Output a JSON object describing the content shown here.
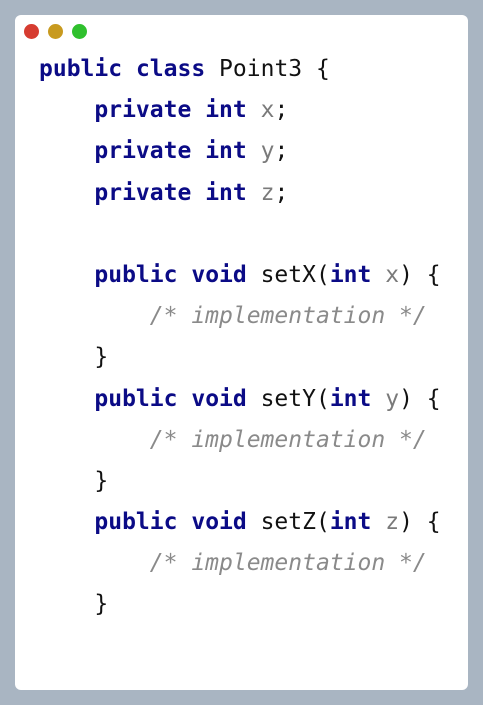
{
  "window": {
    "controls": [
      {
        "name": "close",
        "color": "#d63c31"
      },
      {
        "name": "minimize",
        "color": "#c89a1f"
      },
      {
        "name": "maximize",
        "color": "#2fc02d"
      }
    ]
  },
  "code": {
    "lines": [
      {
        "indent": "",
        "tokens": [
          {
            "t": "public",
            "k": "kw"
          },
          {
            "t": " ",
            "k": "plain"
          },
          {
            "t": "class",
            "k": "kw"
          },
          {
            "t": " Point3 {",
            "k": "plain"
          }
        ]
      },
      {
        "indent": "    ",
        "tokens": [
          {
            "t": "private",
            "k": "kw"
          },
          {
            "t": " ",
            "k": "plain"
          },
          {
            "t": "int",
            "k": "kw"
          },
          {
            "t": " ",
            "k": "plain"
          },
          {
            "t": "x",
            "k": "var"
          },
          {
            "t": ";",
            "k": "plain"
          }
        ]
      },
      {
        "indent": "    ",
        "tokens": [
          {
            "t": "private",
            "k": "kw"
          },
          {
            "t": " ",
            "k": "plain"
          },
          {
            "t": "int",
            "k": "kw"
          },
          {
            "t": " ",
            "k": "plain"
          },
          {
            "t": "y",
            "k": "var"
          },
          {
            "t": ";",
            "k": "plain"
          }
        ]
      },
      {
        "indent": "    ",
        "tokens": [
          {
            "t": "private",
            "k": "kw"
          },
          {
            "t": " ",
            "k": "plain"
          },
          {
            "t": "int",
            "k": "kw"
          },
          {
            "t": " ",
            "k": "plain"
          },
          {
            "t": "z",
            "k": "var"
          },
          {
            "t": ";",
            "k": "plain"
          }
        ]
      },
      {
        "indent": "",
        "tokens": []
      },
      {
        "indent": "    ",
        "tokens": [
          {
            "t": "public",
            "k": "kw"
          },
          {
            "t": " ",
            "k": "plain"
          },
          {
            "t": "void",
            "k": "kw"
          },
          {
            "t": " setX(",
            "k": "plain"
          },
          {
            "t": "int",
            "k": "kw"
          },
          {
            "t": " ",
            "k": "plain"
          },
          {
            "t": "x",
            "k": "var"
          },
          {
            "t": ") {",
            "k": "plain"
          }
        ]
      },
      {
        "indent": "        ",
        "tokens": [
          {
            "t": "/* implementation */",
            "k": "comment"
          }
        ]
      },
      {
        "indent": "    ",
        "tokens": [
          {
            "t": "}",
            "k": "plain"
          }
        ]
      },
      {
        "indent": "    ",
        "tokens": [
          {
            "t": "public",
            "k": "kw"
          },
          {
            "t": " ",
            "k": "plain"
          },
          {
            "t": "void",
            "k": "kw"
          },
          {
            "t": " setY(",
            "k": "plain"
          },
          {
            "t": "int",
            "k": "kw"
          },
          {
            "t": " ",
            "k": "plain"
          },
          {
            "t": "y",
            "k": "var"
          },
          {
            "t": ") {",
            "k": "plain"
          }
        ]
      },
      {
        "indent": "        ",
        "tokens": [
          {
            "t": "/* implementation */",
            "k": "comment"
          }
        ]
      },
      {
        "indent": "    ",
        "tokens": [
          {
            "t": "}",
            "k": "plain"
          }
        ]
      },
      {
        "indent": "    ",
        "tokens": [
          {
            "t": "public",
            "k": "kw"
          },
          {
            "t": " ",
            "k": "plain"
          },
          {
            "t": "void",
            "k": "kw"
          },
          {
            "t": " setZ(",
            "k": "plain"
          },
          {
            "t": "int",
            "k": "kw"
          },
          {
            "t": " ",
            "k": "plain"
          },
          {
            "t": "z",
            "k": "var"
          },
          {
            "t": ") {",
            "k": "plain"
          }
        ]
      },
      {
        "indent": "        ",
        "tokens": [
          {
            "t": "/* implementation */",
            "k": "comment"
          }
        ]
      },
      {
        "indent": "    ",
        "tokens": [
          {
            "t": "}",
            "k": "plain"
          }
        ]
      }
    ]
  }
}
